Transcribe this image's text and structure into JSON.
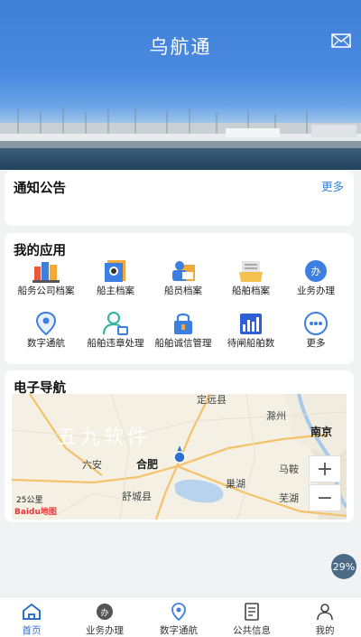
{
  "app": {
    "title": "乌航通"
  },
  "notice": {
    "title": "通知公告",
    "more": "更多"
  },
  "apps": {
    "title": "我的应用",
    "items": [
      {
        "label": "船务公司档案",
        "icon": "company-archive-icon"
      },
      {
        "label": "船主档案",
        "icon": "owner-archive-icon"
      },
      {
        "label": "船员档案",
        "icon": "crew-archive-icon"
      },
      {
        "label": "船舶档案",
        "icon": "ship-archive-icon"
      },
      {
        "label": "业务办理",
        "icon": "business-icon"
      },
      {
        "label": "数字通航",
        "icon": "location-pin-icon"
      },
      {
        "label": "船舶违章处理",
        "icon": "violation-icon"
      },
      {
        "label": "船舶诚信管理",
        "icon": "credit-lock-icon"
      },
      {
        "label": "待闸船舶数",
        "icon": "bar-chart-icon"
      },
      {
        "label": "更多",
        "icon": "more-dots-icon"
      }
    ]
  },
  "map": {
    "title": "电子导航",
    "watermark": "五九软件",
    "cities": [
      "定远县",
      "滁州",
      "南京",
      "六安",
      "合肥",
      "马鞍",
      "巢湖",
      "舒城县",
      "芜湖"
    ],
    "scale": "25公里",
    "logo": "Baidu地图",
    "zoom_in": "+",
    "zoom_out": "−"
  },
  "badge": "29%",
  "tabs": [
    {
      "label": "首页",
      "icon": "home-icon",
      "active": true
    },
    {
      "label": "业务办理",
      "icon": "business-icon"
    },
    {
      "label": "数字通航",
      "icon": "location-pin-icon"
    },
    {
      "label": "公共信息",
      "icon": "document-icon"
    },
    {
      "label": "我的",
      "icon": "user-icon"
    }
  ]
}
